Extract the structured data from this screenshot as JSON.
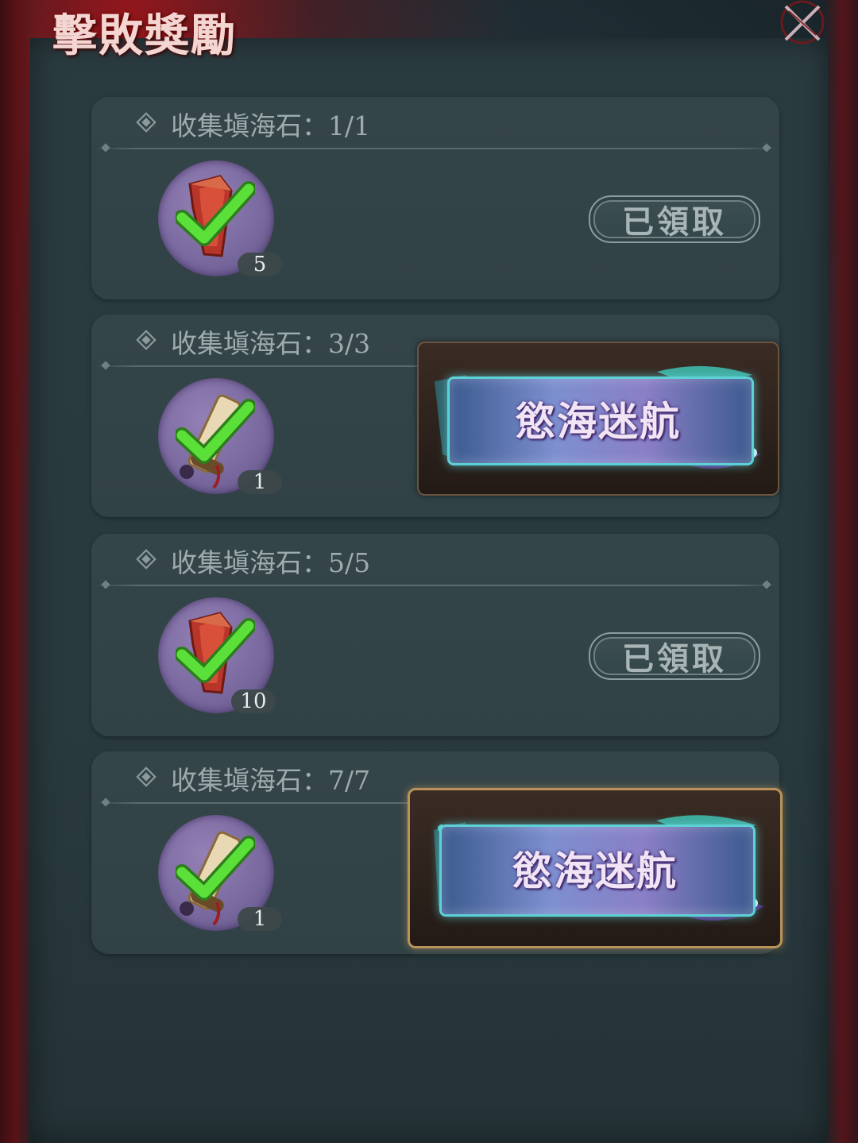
{
  "title": "擊敗獎勵",
  "tasks": [
    {
      "label": "收集塡海石：1/1",
      "reward_item": "red-crystal-icon",
      "quantity": "5",
      "action": "已領取"
    },
    {
      "label": "收集塡海石：3/3",
      "reward_item": "scroll-icon",
      "quantity": "1",
      "action": "慾海迷航"
    },
    {
      "label": "收集塡海石：5/5",
      "reward_item": "red-crystal-icon",
      "quantity": "10",
      "action": "已領取"
    },
    {
      "label": "收集塡海石：7/7",
      "reward_item": "scroll-icon",
      "quantity": "1",
      "action": "慾海迷航"
    }
  ],
  "colors": {
    "accent_red": "#b01a20",
    "panel": "#2a3b40",
    "card": "#344549",
    "check_green": "#5be03a",
    "reward_circle": "#7a6aa0"
  }
}
